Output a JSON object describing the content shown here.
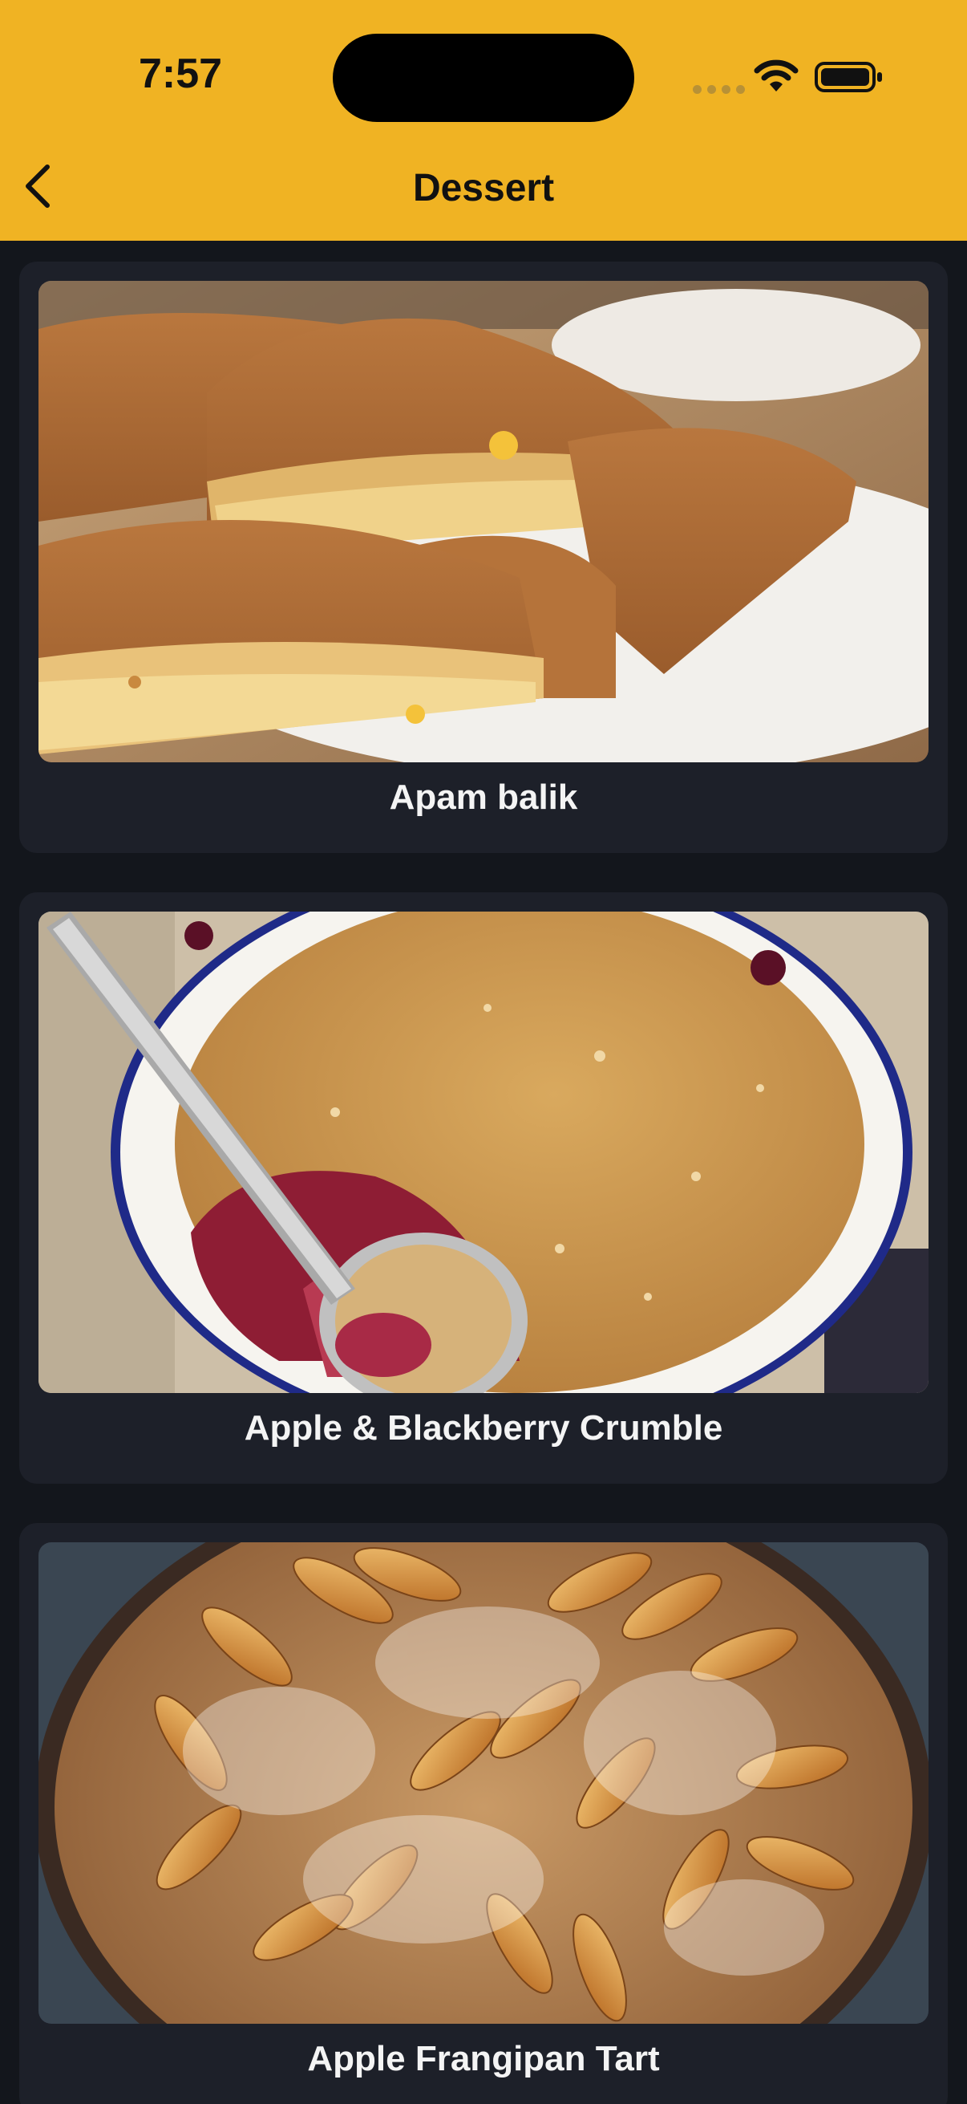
{
  "status_bar": {
    "time": "7:57"
  },
  "nav": {
    "title": "Dessert",
    "back_icon": "chevron-left-icon"
  },
  "meals": [
    {
      "name": "Apam balik"
    },
    {
      "name": "Apple & Blackberry Crumble"
    },
    {
      "name": "Apple Frangipan Tart"
    }
  ],
  "colors": {
    "header": "#f0b323",
    "background": "#13161c",
    "card": "#1d2029",
    "title_text": "#f4f4f4"
  }
}
